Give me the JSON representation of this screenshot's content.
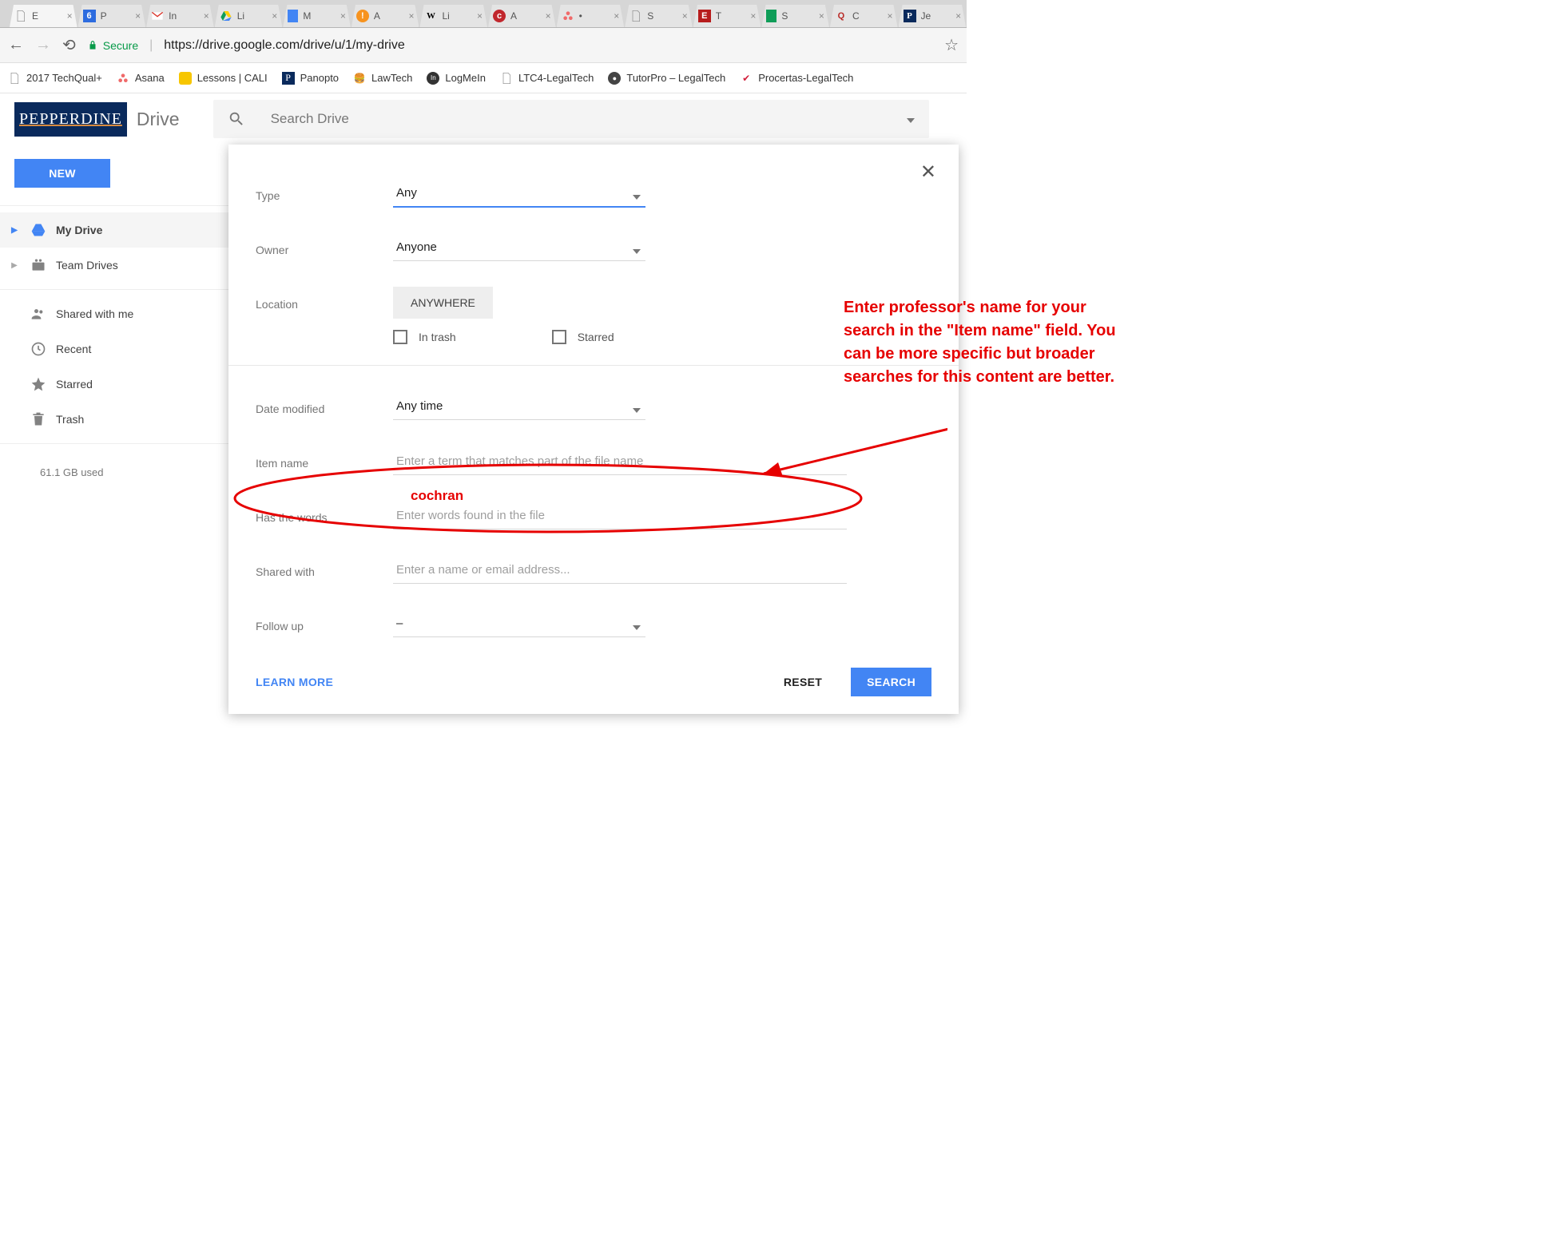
{
  "browser": {
    "tabs": [
      {
        "label": "E",
        "icon": "page"
      },
      {
        "label": "P",
        "icon": "6"
      },
      {
        "label": "In",
        "icon": "gmail"
      },
      {
        "label": "Li",
        "icon": "gdrive"
      },
      {
        "label": "M",
        "icon": "docs"
      },
      {
        "label": "A",
        "icon": "alert"
      },
      {
        "label": "Li",
        "icon": "wiki"
      },
      {
        "label": "A",
        "icon": "cali"
      },
      {
        "label": "•",
        "icon": "asana"
      },
      {
        "label": "S",
        "icon": "page"
      },
      {
        "label": "T",
        "icon": "e"
      },
      {
        "label": "S",
        "icon": "sheets"
      },
      {
        "label": "C",
        "icon": "q"
      },
      {
        "label": "Je",
        "icon": "p"
      }
    ],
    "secure_label": "Secure",
    "url": "https://drive.google.com/drive/u/1/my-drive",
    "bookmarks": [
      {
        "label": "2017 TechQual+",
        "icon": "page"
      },
      {
        "label": "Asana",
        "icon": "asana"
      },
      {
        "label": "Lessons | CALI",
        "icon": "cali"
      },
      {
        "label": "Panopto",
        "icon": "panopto"
      },
      {
        "label": "LawTech",
        "icon": "law"
      },
      {
        "label": "LogMeIn",
        "icon": "in"
      },
      {
        "label": "LTC4-LegalTech",
        "icon": "page"
      },
      {
        "label": "TutorPro – LegalTech",
        "icon": "tutor"
      },
      {
        "label": "Procertas-LegalTech",
        "icon": "proc"
      }
    ]
  },
  "drive": {
    "logo": "PEPPERDINE",
    "product": "Drive",
    "search_placeholder": "Search Drive",
    "new_button": "NEW",
    "nav_mydrive": "My Drive",
    "nav_teamdrives": "Team Drives",
    "nav_shared": "Shared with me",
    "nav_recent": "Recent",
    "nav_starred": "Starred",
    "nav_trash": "Trash",
    "storage": "61.1 GB used"
  },
  "filter": {
    "type_label": "Type",
    "type_value": "Any",
    "owner_label": "Owner",
    "owner_value": "Anyone",
    "location_label": "Location",
    "location_value": "ANYWHERE",
    "in_trash_label": "In trash",
    "starred_label": "Starred",
    "date_label": "Date modified",
    "date_value": "Any time",
    "itemname_label": "Item name",
    "itemname_placeholder": "Enter a term that matches part of the file name",
    "words_label": "Has the words",
    "words_placeholder": "Enter words found in the file",
    "sharedwith_label": "Shared with",
    "sharedwith_placeholder": "Enter a name or email address...",
    "followup_label": "Follow up",
    "followup_value": "–",
    "learn_more": "LEARN MORE",
    "reset": "RESET",
    "search": "SEARCH"
  },
  "annotation": {
    "text": "Enter professor's name for your search in the \"Item name\" field.  You can be more specific but broader searches for this content are better.",
    "overlay_word": "cochran"
  }
}
